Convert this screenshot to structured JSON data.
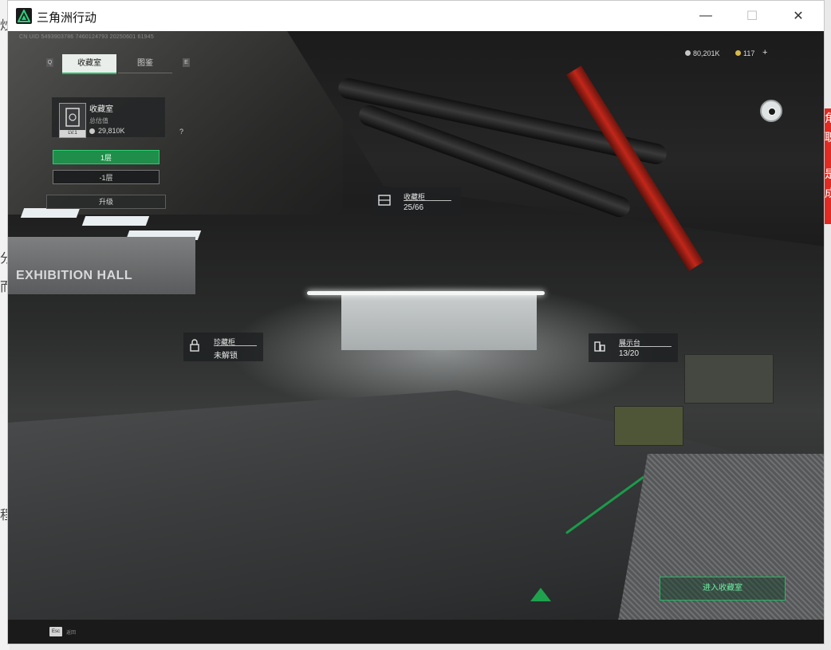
{
  "window": {
    "title": "三角洲行动"
  },
  "left_strip_chars": [
    "炒",
    "分",
    "而",
    "程"
  ],
  "right_strip_chars": [
    "角",
    "职",
    "是",
    "成"
  ],
  "hud": {
    "id_text": "CN UID 5493903786 7460124793 20250601 61945",
    "tabs": {
      "left_key": "Q",
      "right_key": "E",
      "active": "收藏室",
      "inactive": "图鉴"
    },
    "collection": {
      "level": "LV.1",
      "title": "收藏室",
      "subtitle": "总估值",
      "value": "29,810K",
      "help": "?"
    },
    "floors": [
      "1层",
      "-1层"
    ],
    "upgrade": "升级",
    "currency": {
      "coins": "80,201K",
      "tokens": "117",
      "plus": "+"
    },
    "tags": {
      "cabinet": {
        "name": "收藏柜",
        "value": "25/66"
      },
      "rare_cabinet": {
        "name": "珍藏柜",
        "value": "未解锁"
      },
      "display": {
        "name": "展示台",
        "value": "13/20"
      }
    },
    "scene_sign": "EXHIBITION HALL",
    "enter_button": "进入收藏室",
    "esc": {
      "key": "Esc",
      "label": "返回"
    }
  },
  "colors": {
    "accent": "#23c06a",
    "red_pipe": "#c2271a"
  },
  "icons": [
    "app-logo-icon",
    "minimize-icon",
    "maximize-icon",
    "close-icon",
    "camera-icon",
    "cabinet-icon",
    "display-icon",
    "coin-icon",
    "token-icon",
    "help-icon"
  ]
}
